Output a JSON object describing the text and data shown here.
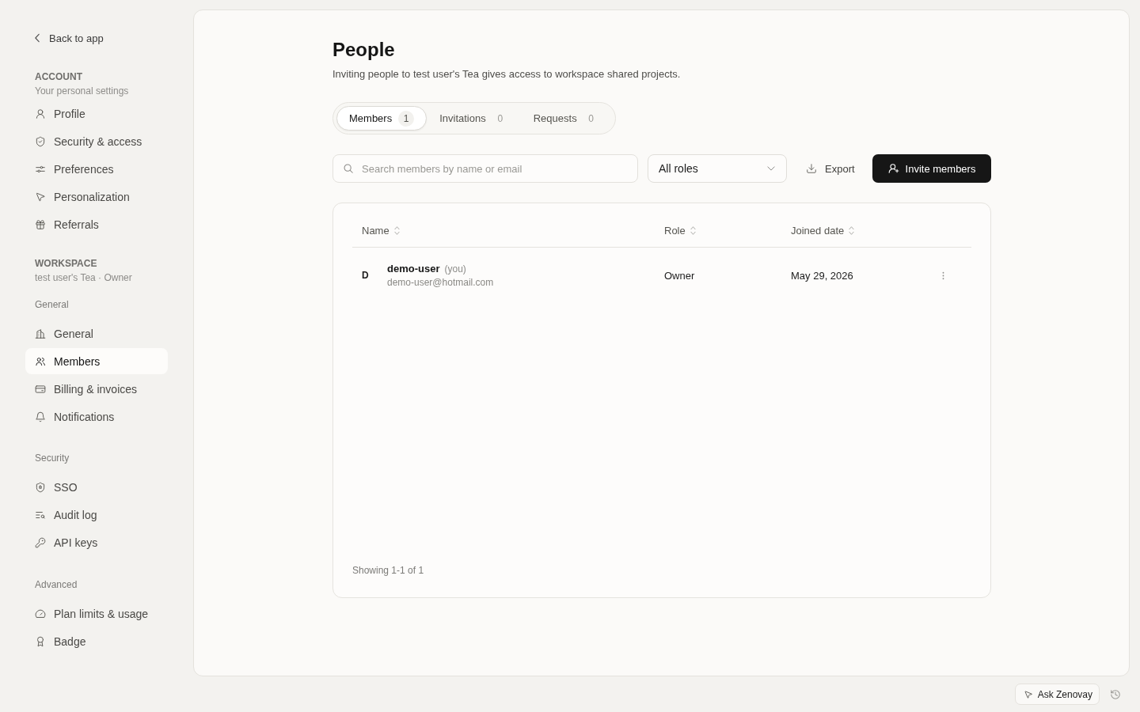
{
  "sidebar": {
    "back_link": "Back to app",
    "sections": [
      {
        "heading": "ACCOUNT",
        "subtitle": "Your personal settings",
        "groups": [
          {
            "items": [
              {
                "label": "Profile",
                "selected": false
              },
              {
                "label": "Security & access",
                "selected": false
              },
              {
                "label": "Preferences",
                "selected": false
              },
              {
                "label": "Personalization",
                "selected": false
              },
              {
                "label": "Referrals",
                "selected": false
              }
            ]
          }
        ]
      },
      {
        "heading": "WORKSPACE",
        "subtitle": "test user's Tea · Owner",
        "groups": [
          {
            "label": "General",
            "items": [
              {
                "label": "General",
                "selected": false
              },
              {
                "label": "Members",
                "selected": true
              },
              {
                "label": "Billing & invoices",
                "selected": false
              },
              {
                "label": "Notifications",
                "selected": false
              }
            ]
          },
          {
            "label": "Security",
            "items": [
              {
                "label": "SSO",
                "selected": false
              },
              {
                "label": "Audit log",
                "selected": false
              },
              {
                "label": "API keys",
                "selected": false
              }
            ]
          },
          {
            "label": "Advanced",
            "items": [
              {
                "label": "Plan limits & usage",
                "selected": false
              },
              {
                "label": "Badge",
                "selected": false
              }
            ]
          }
        ]
      }
    ]
  },
  "page": {
    "title": "People",
    "subtitle": "Inviting people to test user's Tea gives access to workspace shared projects."
  },
  "tabs": [
    {
      "label": "Members",
      "count": "1",
      "selected": true
    },
    {
      "label": "Invitations",
      "count": "0",
      "selected": false
    },
    {
      "label": "Requests",
      "count": "0",
      "selected": false
    }
  ],
  "toolbar": {
    "search": {
      "placeholder": "Search members by name or email"
    },
    "role_filter": {
      "value": "All roles"
    },
    "export_button": "Export",
    "invite_button": "Invite members"
  },
  "table": {
    "columns": [
      {
        "label": "Name"
      },
      {
        "label": "Role"
      },
      {
        "label": "Joined date"
      }
    ],
    "rows": [
      {
        "initial": "D",
        "name": "demo-user",
        "note": "(you)",
        "email": "demo-user@hotmail.com",
        "role": "Owner",
        "joined_date": "May 29, 2026"
      }
    ],
    "footer": "Showing 1-1 of 1"
  },
  "bottom_bar": {
    "assistant_button": "Ask Zenovay"
  }
}
